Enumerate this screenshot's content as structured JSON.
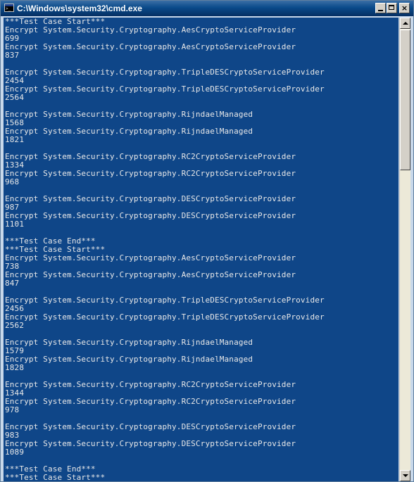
{
  "window": {
    "title": "C:\\Windows\\system32\\cmd.exe",
    "icon": "cmd-app-icon",
    "controls": {
      "minimize_icon": "minimize-icon",
      "maximize_icon": "maximize-icon",
      "close_icon": "close-icon",
      "close_glyph": "×"
    }
  },
  "console": {
    "background_color": "#0f4688",
    "text_color": "#e8e8e8",
    "lines": [
      "***Test Case Start***",
      "Encrypt System.Security.Cryptography.AesCryptoServiceProvider",
      "699",
      "Encrypt System.Security.Cryptography.AesCryptoServiceProvider",
      "837",
      "",
      "Encrypt System.Security.Cryptography.TripleDESCryptoServiceProvider",
      "2454",
      "Encrypt System.Security.Cryptography.TripleDESCryptoServiceProvider",
      "2564",
      "",
      "Encrypt System.Security.Cryptography.RijndaelManaged",
      "1568",
      "Encrypt System.Security.Cryptography.RijndaelManaged",
      "1821",
      "",
      "Encrypt System.Security.Cryptography.RC2CryptoServiceProvider",
      "1334",
      "Encrypt System.Security.Cryptography.RC2CryptoServiceProvider",
      "968",
      "",
      "Encrypt System.Security.Cryptography.DESCryptoServiceProvider",
      "987",
      "Encrypt System.Security.Cryptography.DESCryptoServiceProvider",
      "1101",
      "",
      "***Test Case End***",
      "***Test Case Start***",
      "Encrypt System.Security.Cryptography.AesCryptoServiceProvider",
      "738",
      "Encrypt System.Security.Cryptography.AesCryptoServiceProvider",
      "847",
      "",
      "Encrypt System.Security.Cryptography.TripleDESCryptoServiceProvider",
      "2456",
      "Encrypt System.Security.Cryptography.TripleDESCryptoServiceProvider",
      "2562",
      "",
      "Encrypt System.Security.Cryptography.RijndaelManaged",
      "1579",
      "Encrypt System.Security.Cryptography.RijndaelManaged",
      "1828",
      "",
      "Encrypt System.Security.Cryptography.RC2CryptoServiceProvider",
      "1344",
      "Encrypt System.Security.Cryptography.RC2CryptoServiceProvider",
      "978",
      "",
      "Encrypt System.Security.Cryptography.DESCryptoServiceProvider",
      "983",
      "Encrypt System.Security.Cryptography.DESCryptoServiceProvider",
      "1089",
      "",
      "***Test Case End***",
      "***Test Case Start***"
    ]
  },
  "scrollbar": {
    "up_icon": "scroll-up-arrow-icon",
    "down_icon": "scroll-down-arrow-icon"
  }
}
